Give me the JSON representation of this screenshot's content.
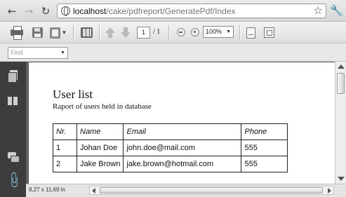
{
  "browser": {
    "url_host": "localhost",
    "url_path": "/cake/pdfreport/GeneratePdf/Index"
  },
  "toolbar": {
    "page_current": "1",
    "page_total": "/ 1",
    "zoom": "100%"
  },
  "find": {
    "placeholder": "Find"
  },
  "document": {
    "title": "User list",
    "subtitle": "Raport of users held in database",
    "table": {
      "headers": [
        "Nr.",
        "Name",
        "Email",
        "Phone"
      ],
      "rows": [
        [
          "1",
          "Johan Doe",
          "john.doe@mail.com",
          "555"
        ],
        [
          "2",
          "Jake Brown",
          "jake.brown@hotmail.com",
          "555"
        ]
      ]
    }
  },
  "status": {
    "page_size": "8,27 x 11,69 in"
  },
  "icons": {
    "back": "back-arrow-icon",
    "forward": "forward-arrow-icon",
    "reload": "reload-icon",
    "bookmark": "star-icon",
    "settings": "wrench-icon",
    "print": "print-icon",
    "save": "save-icon",
    "export": "export-icon",
    "grid": "grid-icon",
    "prev_page": "arrow-up-icon",
    "next_page": "arrow-down-icon",
    "zoom_out": "zoom-out-icon",
    "zoom_in": "zoom-in-icon",
    "fit_width": "fit-width-icon",
    "fit_page": "fit-page-icon",
    "pages_panel": "pages-icon",
    "bookmarks_panel": "bookmarks-icon",
    "comments_panel": "comments-icon",
    "attachments_panel": "paperclip-icon"
  },
  "colors": {
    "left_panel": "#3d3d3d",
    "viewport_bg": "#5e5e5e",
    "page_bg": "#ffffff"
  }
}
